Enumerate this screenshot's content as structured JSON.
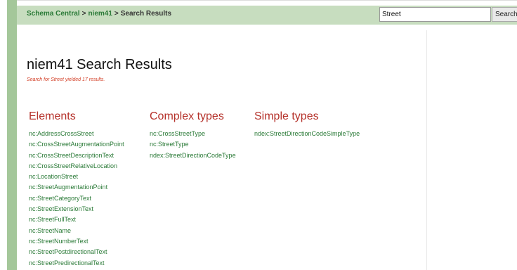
{
  "breadcrumb": {
    "root": "Schema Central",
    "separator": ">",
    "namespace": "niem41",
    "current": "Search Results"
  },
  "search": {
    "value": "Street",
    "button_label": "Search"
  },
  "page": {
    "title": "niem41 Search Results",
    "summary": "Search for Street yielded 17 results."
  },
  "columns": {
    "elements": {
      "heading": "Elements",
      "items": [
        "nc:AddressCrossStreet",
        "nc:CrossStreetAugmentationPoint",
        "nc:CrossStreetDescriptionText",
        "nc:CrossStreetRelativeLocation",
        "nc:LocationStreet",
        "nc:StreetAugmentationPoint",
        "nc:StreetCategoryText",
        "nc:StreetExtensionText",
        "nc:StreetFullText",
        "nc:StreetName",
        "nc:StreetNumberText",
        "nc:StreetPostdirectionalText",
        "nc:StreetPredirectionalText"
      ]
    },
    "complex_types": {
      "heading": "Complex types",
      "items": [
        "nc:CrossStreetType",
        "nc:StreetType",
        "ndex:StreetDirectionCodeType"
      ]
    },
    "simple_types": {
      "heading": "Simple types",
      "items": [
        "ndex:StreetDirectionCodeSimpleType"
      ]
    }
  },
  "colors": {
    "header_bg": "#c7ddbf",
    "rail": "#a4c79a",
    "link": "#2a7a37",
    "heading": "#b5312a",
    "summary": "#d23b22"
  }
}
